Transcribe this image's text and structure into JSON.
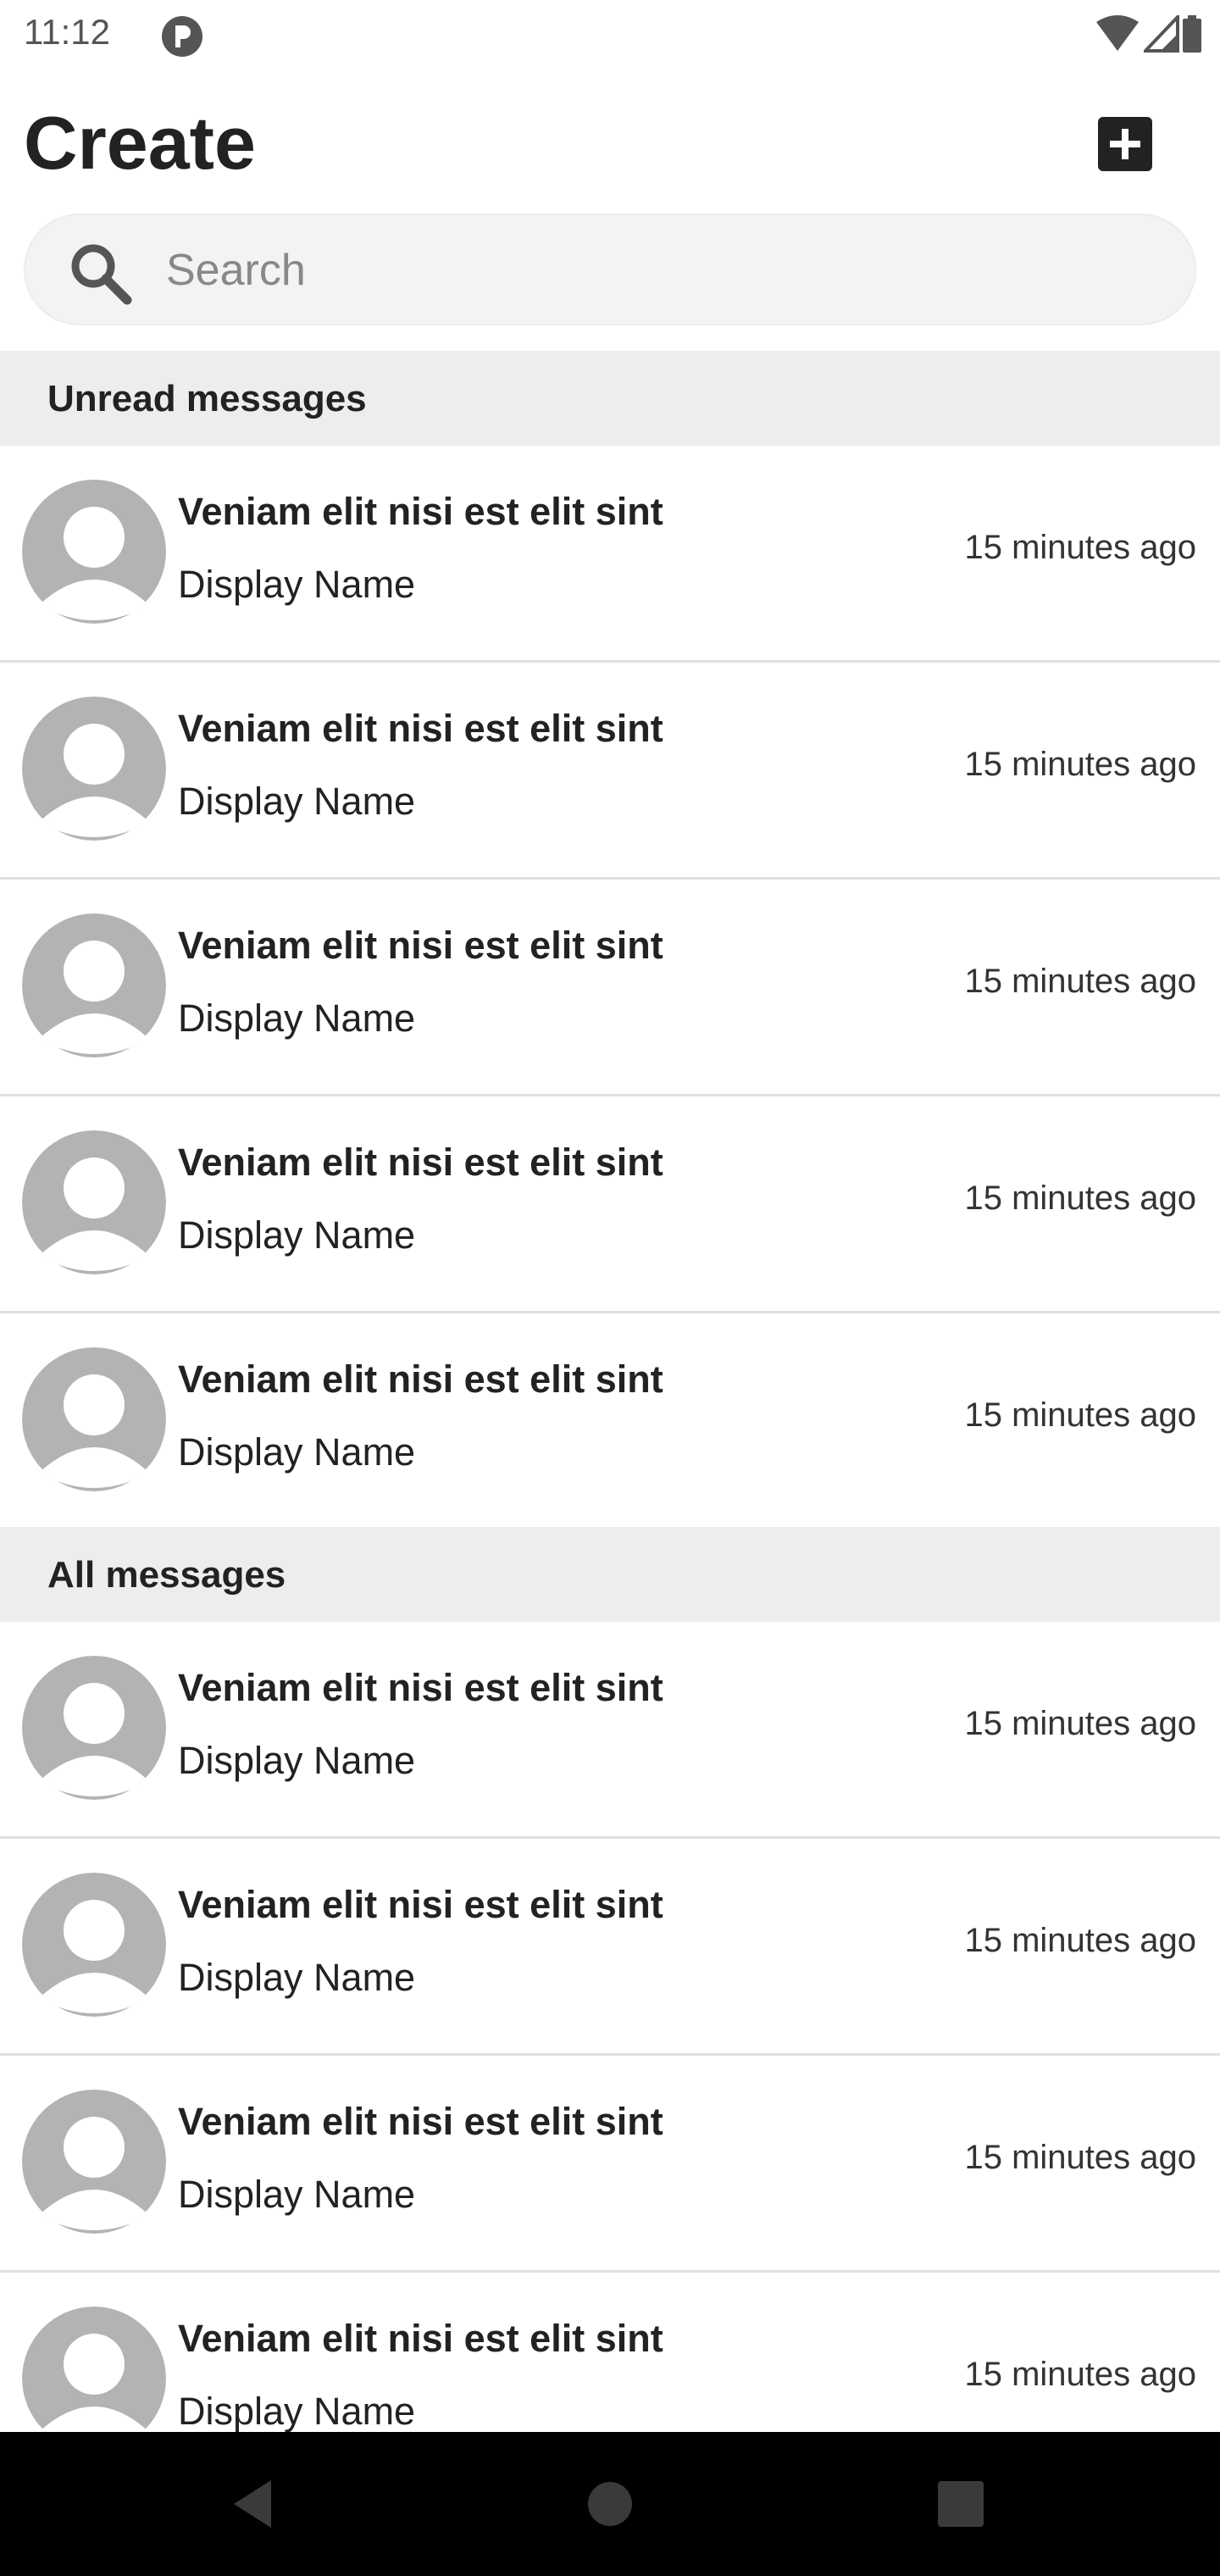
{
  "status_bar": {
    "time": "11:12",
    "app_icon": "p-circle-icon",
    "right_icons": [
      "wifi-icon",
      "signal-icon",
      "battery-icon"
    ]
  },
  "header": {
    "title": "Create",
    "add_icon": "plus-square-icon"
  },
  "search": {
    "placeholder": "Search",
    "value": "",
    "icon": "search-icon"
  },
  "sections": [
    {
      "title": "Unread messages",
      "items": [
        {
          "title": "Veniam elit nisi est elit sint",
          "subtitle": "Display Name",
          "time": "15 minutes ago"
        },
        {
          "title": "Veniam elit nisi est elit sint",
          "subtitle": "Display Name",
          "time": "15 minutes ago"
        },
        {
          "title": "Veniam elit nisi est elit sint",
          "subtitle": "Display Name",
          "time": "15 minutes ago"
        },
        {
          "title": "Veniam elit nisi est elit sint",
          "subtitle": "Display Name",
          "time": "15 minutes ago"
        },
        {
          "title": "Veniam elit nisi est elit sint",
          "subtitle": "Display Name",
          "time": "15 minutes ago"
        }
      ]
    },
    {
      "title": "All messages",
      "items": [
        {
          "title": "Veniam elit nisi est elit sint",
          "subtitle": "Display Name",
          "time": "15 minutes ago"
        },
        {
          "title": "Veniam elit nisi est elit sint",
          "subtitle": "Display Name",
          "time": "15 minutes ago"
        },
        {
          "title": "Veniam elit nisi est elit sint",
          "subtitle": "Display Name",
          "time": "15 minutes ago"
        },
        {
          "title": "Veniam elit nisi est elit sint",
          "subtitle": "Display Name",
          "time": "15 minutes ago"
        }
      ]
    }
  ],
  "nav_bar": {
    "buttons": [
      "back-icon",
      "home-icon",
      "recents-icon"
    ]
  },
  "colors": {
    "section_bg": "#ededed",
    "avatar": "#b3b3b3",
    "text": "#222222",
    "nav_bg": "#000000"
  }
}
